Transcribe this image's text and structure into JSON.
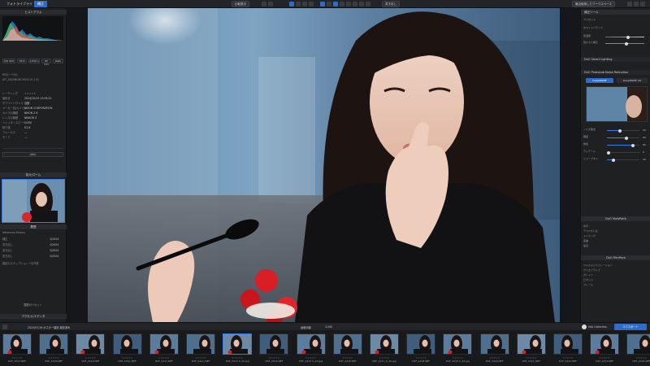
{
  "topbar": {
    "tab_library": "フォトライブラリ",
    "tab_develop": "補正",
    "btn_compare": "比較表示",
    "btn_export": "書き出し",
    "btn_batch": "一括処理",
    "workspace": "最近使用したワークスペース",
    "brand": "ダイヤモンド"
  },
  "left": {
    "histogram_title": "ヒストグラム",
    "info_title": "情報",
    "folder_label": "SDカード(3)",
    "filename": "JXT_2405NOW 2024-10-1 ID",
    "exif_rows": [
      {
        "k": "レーティング",
        "v": "★★★★★"
      },
      {
        "k": "撮影日",
        "v": "2024/10/15 13:09:21"
      },
      {
        "k": "ホワイトバランス",
        "v": "自動"
      },
      {
        "k": "メーカー名(カメラ)",
        "v": "NIKON CORPORATION"
      },
      {
        "k": "カメラの機種",
        "v": "NIKON Z 6"
      },
      {
        "k": "レンズの機種",
        "v": "NIKKOR Z"
      },
      {
        "k": "シャッタースピード",
        "v": "1/250"
      },
      {
        "k": "絞り値",
        "v": "f/2.8"
      },
      {
        "k": "フォーカス",
        "v": "---"
      },
      {
        "k": "モード",
        "v": "---"
      }
    ],
    "pills": [
      "ISO 400",
      "f/2.8",
      "1/250 s",
      "85 mm",
      "RAW",
      "JPEG"
    ],
    "loupe_title": "拡大/ズーム",
    "zoom_label": "100%",
    "history_title": "履歴",
    "history_header": "Advanced History",
    "history_rows": [
      {
        "k": "補正",
        "v": "1/2024"
      },
      {
        "k": "書き出し",
        "v": "1/2024"
      },
      {
        "k": "書き出し",
        "v": "1/2024"
      },
      {
        "k": "書き出し",
        "v": "1/2024"
      }
    ],
    "history_note": "既定のスナップショットを作成",
    "reset_label": "履歴のリセット",
    "footer": "アクセス/エディタ"
  },
  "right": {
    "title": "補正ツール",
    "presets": "プリセット",
    "section_basic": "ホワイトバランス",
    "wb_label": "色温度",
    "tint_label": "色かぶり補正",
    "section_lighting": "DxO Smart Lighting",
    "section_denoise": "DxO PhotoLab Noise Reduction",
    "denoise_modes": [
      "DeepPRIME",
      "DeepPRIME XD"
    ],
    "sliders": [
      {
        "label": "ノイズ除去",
        "value": "40"
      },
      {
        "label": "輝度",
        "value": "60"
      },
      {
        "label": "偽色",
        "value": "80"
      },
      {
        "label": "ディテール",
        "value": "0"
      },
      {
        "label": "シャープネス",
        "value": "20"
      }
    ],
    "section_geometry": "DxO ViewPoint",
    "section_film": "DxO FilmPack",
    "geometry_rows": [
      "水平",
      "アスペクト比",
      "トリミング",
      "歪曲",
      "遠近"
    ],
    "film_rows": [
      "フィルムシミュレーション",
      "クリエイティブ",
      "グレイン",
      "ビネット",
      "フレーム"
    ],
    "footer_btn": "エクスポート"
  },
  "filmbar": {
    "path": "2023/07/16 ポスター撮影 撮影済み",
    "count": "1/190",
    "zoom": "画像情報",
    "collection": "Hdk Collection",
    "export_btn": "エクスポート"
  },
  "filmstrip": {
    "files": [
      "DSF_2417.NEF",
      "DSF_2418.NEF",
      "DSF_2419.NEF",
      "DSF_2410_NEF",
      "DSF_2411.NEF",
      "DSF_2412_NEF",
      "DSF_2413 X_20.jpg",
      "DSF_2414.NEF",
      "DSF_2415 X_20.jpg",
      "DSF_2416.NEF",
      "DSF_2417_X_20.jpg",
      "DSF_2418.NEF",
      "DSF_2419 X_20.jpg",
      "DSF_2420.NEF",
      "DSF_2421_NEF",
      "DSF_2422.NEF",
      "DSF_2423.NEF",
      "DSF_2424.NEF"
    ]
  }
}
